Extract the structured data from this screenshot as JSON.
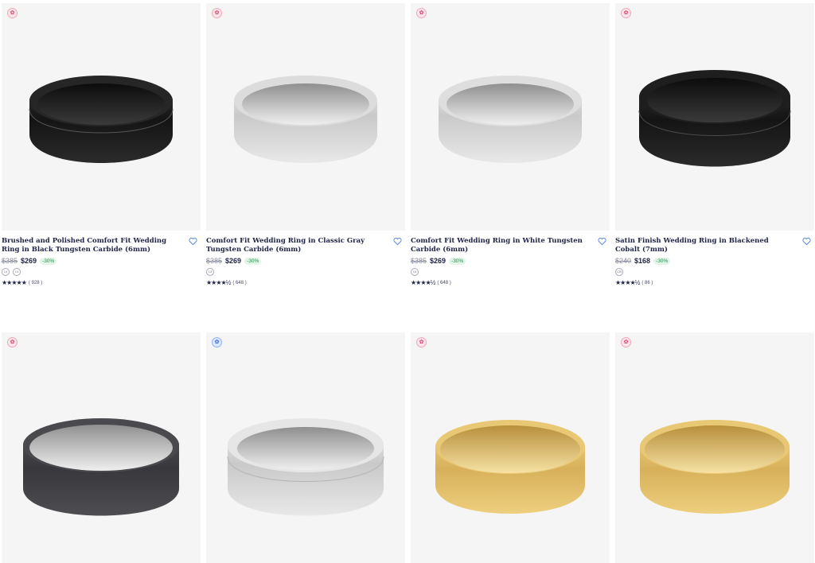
{
  "products": [
    {
      "title": "Brushed and Polished Comfort Fit Wedding Ring in Black Tungsten Carbide (6mm)",
      "old_price": "$385",
      "price": "$269",
      "discount": "-30%",
      "swatches": [
        "14",
        "14"
      ],
      "stars": "★★★★★",
      "reviews": "( 928 )",
      "badge": "pink-badge-icon",
      "metal": "black-polished"
    },
    {
      "title": "Comfort Fit Wedding Ring in Classic Gray Tungsten Carbide (6mm)",
      "old_price": "$385",
      "price": "$269",
      "discount": "-30%",
      "swatches": [
        "14"
      ],
      "stars": "★★★★½",
      "reviews": "( 648 )",
      "badge": "pink-badge-icon",
      "metal": "silver"
    },
    {
      "title": "Comfort Fit Wedding Ring in White Tungsten Carbide (6mm)",
      "old_price": "$385",
      "price": "$269",
      "discount": "-30%",
      "swatches": [
        "14"
      ],
      "stars": "★★★★½",
      "reviews": "( 648 )",
      "badge": "pink-badge-icon",
      "metal": "silver"
    },
    {
      "title": "Satin Finish Wedding Ring in Blackened Cobalt (7mm)",
      "old_price": "$240",
      "price": "$168",
      "discount": "-30%",
      "swatches": [
        "CB"
      ],
      "stars": "★★★★½",
      "reviews": "( 86 )",
      "badge": "pink-badge-icon",
      "metal": "black-satin"
    },
    {
      "badge": "pink-badge-icon",
      "metal": "gunmetal"
    },
    {
      "badge": "blue-badge-icon",
      "metal": "silver-brushed"
    },
    {
      "badge": "pink-badge-icon",
      "metal": "yellow-gold"
    },
    {
      "badge": "pink-badge-icon",
      "metal": "yellow-gold"
    }
  ],
  "colors": {
    "text": "#1f2346",
    "discount": "#1f8f4e",
    "heart": "#5b8ad9",
    "badge_pink": "#d63a62",
    "badge_blue": "#2d5fd6",
    "tile_bg": "#f5f5f5"
  }
}
